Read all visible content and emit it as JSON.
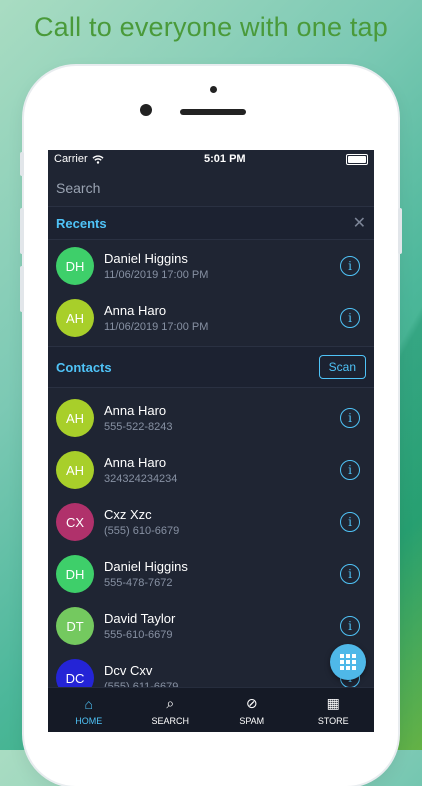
{
  "headline": "Call to everyone with one tap",
  "status": {
    "carrier": "Carrier",
    "time": "5:01 PM"
  },
  "search": {
    "placeholder": "Search"
  },
  "recents": {
    "title": "Recents",
    "items": [
      {
        "initials": "DH",
        "name": "Daniel Higgins",
        "sub": "11/06/2019 17:00 PM",
        "color": "#3ecf6a"
      },
      {
        "initials": "AH",
        "name": "Anna Haro",
        "sub": "11/06/2019 17:00 PM",
        "color": "#a8cf2a"
      }
    ]
  },
  "contacts": {
    "title": "Contacts",
    "scan_label": "Scan",
    "items": [
      {
        "initials": "AH",
        "name": "Anna Haro",
        "sub": "555-522-8243",
        "color": "#a8cf2a"
      },
      {
        "initials": "AH",
        "name": "Anna Haro",
        "sub": "324324234234",
        "color": "#a8cf2a"
      },
      {
        "initials": "CX",
        "name": "Cxz Xzc",
        "sub": "(555) 610-6679",
        "color": "#b0316b"
      },
      {
        "initials": "DH",
        "name": "Daniel Higgins",
        "sub": "555-478-7672",
        "color": "#3ecf6a"
      },
      {
        "initials": "DT",
        "name": "David Taylor",
        "sub": "555-610-6679",
        "color": "#74c95f"
      },
      {
        "initials": "DC",
        "name": "Dcv Cxv",
        "sub": "(555) 611-6679",
        "color": "#2424d6"
      }
    ]
  },
  "tabs": [
    {
      "label": "HOME",
      "icon": "home-icon",
      "glyph": "⌂"
    },
    {
      "label": "SEARCH",
      "icon": "search-icon",
      "glyph": "⌕"
    },
    {
      "label": "SPAM",
      "icon": "spam-icon",
      "glyph": "⊘"
    },
    {
      "label": "STORE",
      "icon": "store-icon",
      "glyph": "▦"
    }
  ],
  "info_glyph": "i"
}
